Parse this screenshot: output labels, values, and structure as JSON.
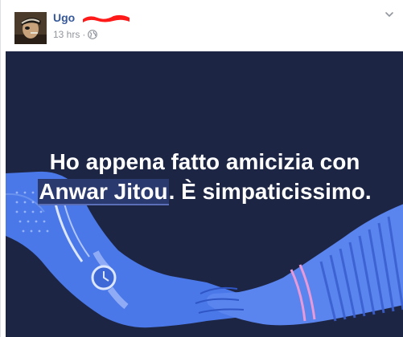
{
  "post": {
    "author_name": "Ugo",
    "timestamp": "13 hrs",
    "separator": "·",
    "privacy_icon": "globe-icon",
    "options_icon": "chevron-down-icon",
    "avatar_icon": "profile-photo"
  },
  "card": {
    "text_before": "Ho appena fatto amicizia con",
    "mention": "Anwar Jitou",
    "text_after": ". È simpaticissimo.",
    "background_color": "#1d2544",
    "arm_color": "#4a78e8"
  },
  "colors": {
    "link": "#365899",
    "meta": "#90949c",
    "redaction": "#ff1a1a"
  }
}
